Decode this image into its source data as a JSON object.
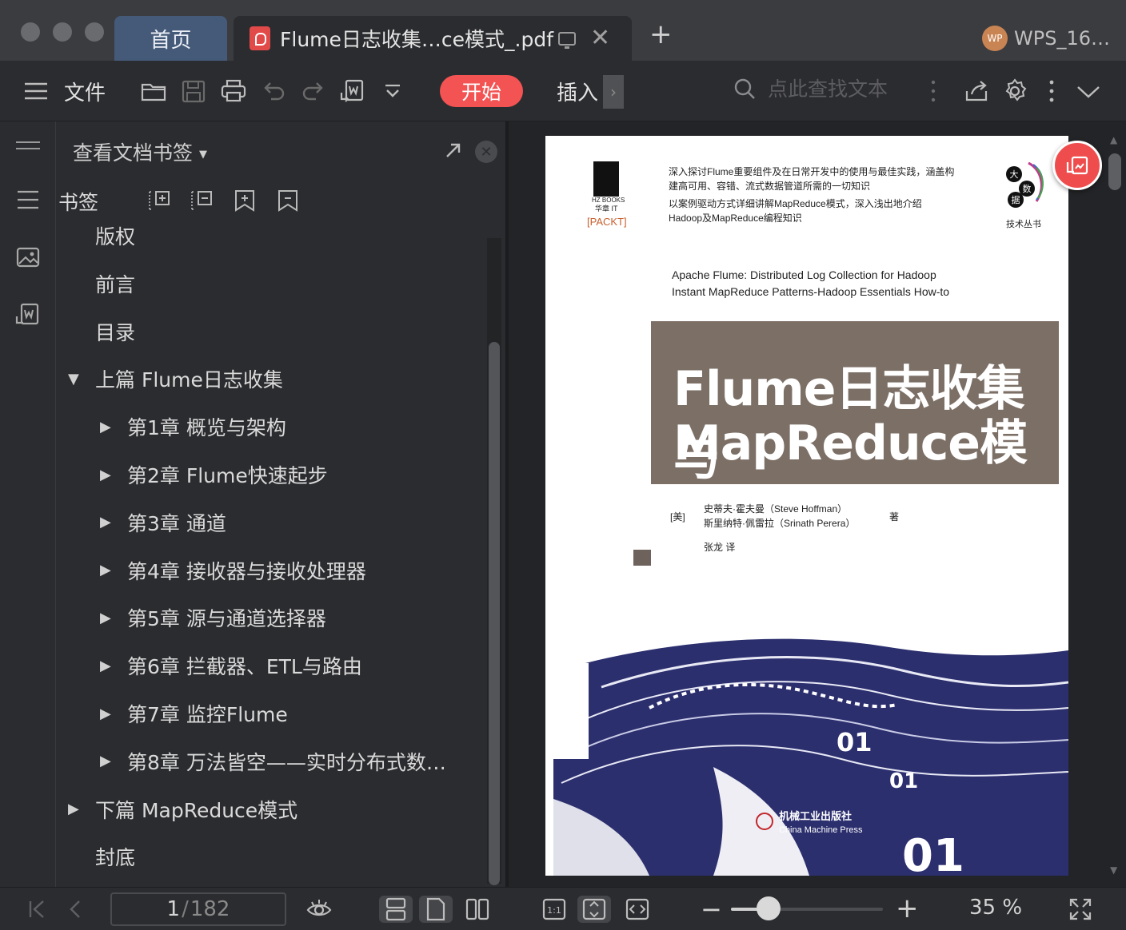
{
  "window": {
    "tabs": [
      {
        "label": "首页"
      },
      {
        "label": "Flume日志收集…ce模式_.pdf"
      }
    ],
    "new_tab_label": "+",
    "account_avatar_text": "WP",
    "account_name": "WPS_16…"
  },
  "toolbar": {
    "menu_label": "文件",
    "start_label": "开始",
    "insert_label": "插入",
    "search_placeholder": "点此查找文本"
  },
  "bookmarks": {
    "header": "查看文档书签",
    "title": "书签",
    "items": [
      {
        "label": "版权",
        "level": 0,
        "toggle": "none"
      },
      {
        "label": "前言",
        "level": 0,
        "toggle": "none"
      },
      {
        "label": "目录",
        "level": 0,
        "toggle": "none"
      },
      {
        "label": "上篇  Flume日志收集",
        "level": 0,
        "toggle": "expanded"
      },
      {
        "label": "第1章  概览与架构",
        "level": 1,
        "toggle": "collapsed"
      },
      {
        "label": "第2章  Flume快速起步",
        "level": 1,
        "toggle": "collapsed"
      },
      {
        "label": "第3章  通道",
        "level": 1,
        "toggle": "collapsed"
      },
      {
        "label": "第4章  接收器与接收处理器",
        "level": 1,
        "toggle": "collapsed"
      },
      {
        "label": "第5章  源与通道选择器",
        "level": 1,
        "toggle": "collapsed"
      },
      {
        "label": "第6章  拦截器、ETL与路由",
        "level": 1,
        "toggle": "collapsed"
      },
      {
        "label": "第7章  监控Flume",
        "level": 1,
        "toggle": "collapsed"
      },
      {
        "label": "第8章  万法皆空——实时分布式数…",
        "level": 1,
        "toggle": "collapsed"
      },
      {
        "label": "下篇  MapReduce模式",
        "level": 0,
        "toggle": "collapsed"
      },
      {
        "label": "封底",
        "level": 0,
        "toggle": "none"
      }
    ]
  },
  "document": {
    "blurb_line1": "深入探讨Flume重要组件及在日常开发中的使用与最佳实践，涵盖构",
    "blurb_line2": "建高可用、容错、流式数据管道所需的一切知识",
    "blurb_line3": "以案例驱动方式详细讲解MapReduce模式，深入浅出地介绍",
    "blurb_line4": "Hadoop及MapReduce编程知识",
    "en_title1": "Apache Flume: Distributed Log Collection for Hadoop",
    "en_title2": "Instant MapReduce Patterns-Hadoop Essentials How-to",
    "title_line1": "Flume日志收集与",
    "title_line2": "MapReduce模式",
    "country": "[美]",
    "author1": "史蒂夫·霍夫曼（Steve Hoffman）",
    "author2": "斯里纳特·佩雷拉（Srinath Perera）",
    "author_role": "著",
    "translator": "张龙  译",
    "publisher_logo_text": "HZ BOOKS",
    "publisher_sub": "华章 IT",
    "packt_text": "[PACKT]",
    "series_logo_chars": [
      "大",
      "数",
      "据"
    ],
    "series_label": "技术丛书",
    "press_name_cn": "机械工业出版社",
    "press_name_en": "China Machine Press",
    "binary_art_text": "01"
  },
  "status": {
    "current_page": "1",
    "total_pages": "182",
    "zoom_level": 35,
    "zoom_text": "35 %"
  },
  "colors": {
    "accent_red": "#f35353",
    "home_tab": "#455a78",
    "cover_band": "#7c6f66"
  }
}
